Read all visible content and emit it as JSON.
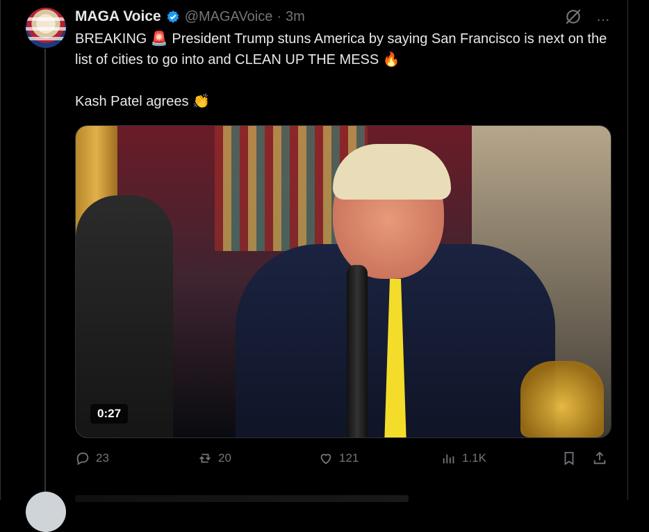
{
  "tweet": {
    "author_name": "MAGA Voice",
    "handle": "@MAGAVoice",
    "separator": "·",
    "time": "3m",
    "text_line1_prefix": "BREAKING",
    "text_line1_siren": "🚨",
    "text_line1_rest": " President Trump stuns America by saying San Francisco is next on the list of cities to go into and CLEAN UP THE MESS ",
    "text_line1_fire": "🔥",
    "text_line2": "Kash Patel agrees ",
    "text_line2_clap": "👏",
    "video_duration": "0:27",
    "stats": {
      "replies": "23",
      "reposts": "20",
      "likes": "121",
      "views": "1.1K"
    }
  },
  "icons": {
    "more": "…"
  },
  "colors": {
    "background": "#000000",
    "muted": "#71767b",
    "text": "#e7e9ea",
    "verified": "#1d9bf0"
  }
}
